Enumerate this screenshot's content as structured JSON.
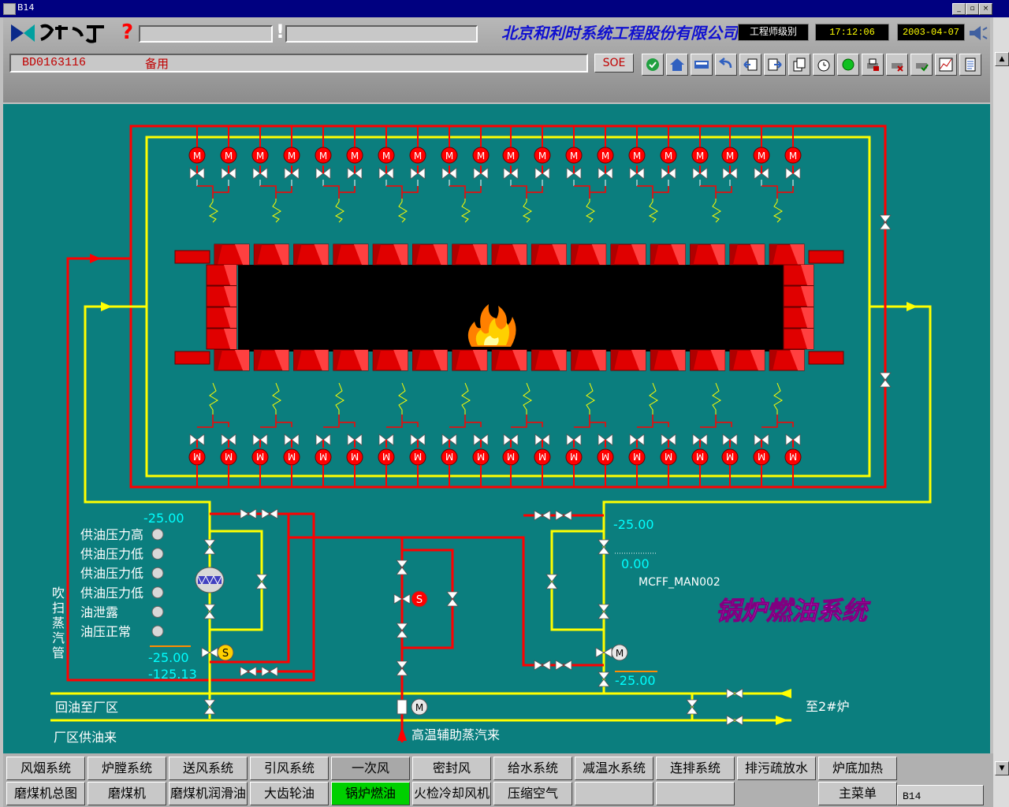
{
  "window": {
    "title": "B14",
    "min": "_",
    "max": "▫",
    "close": "×"
  },
  "header": {
    "help_symbol": "?",
    "alarm_symbol": "!",
    "company": "北京和利时系统工程股份有限公司",
    "user_level": "工程师级别",
    "time": "17:12:06",
    "date": "2003-04-07",
    "point_id": "BD0163116",
    "point_desc": "备用",
    "soe_label": "SOE",
    "toolbar_icons": [
      "globe-check-icon",
      "house-icon",
      "bus-icon",
      "back-arrow-icon",
      "page-left-icon",
      "page-right-icon",
      "copy-pages-icon",
      "clock-icon",
      "green-ball-icon",
      "printer-icon",
      "alarm-cancel-icon",
      "confirm-icon",
      "trend-chart-icon",
      "report-icon"
    ]
  },
  "diagram": {
    "title": "锅炉燃油系统",
    "interlocks": [
      "供油压力高",
      "供油压力低",
      "供油压力低",
      "供油压力低",
      "油泄露",
      "油压正常"
    ],
    "values": {
      "left_top": "-25.00",
      "left_mid": "-25.00",
      "left_bottom": "-125.13",
      "right_top": "-25.00",
      "right_mid": "0.00",
      "right_bottom": "-25.00"
    },
    "tag_name": "MCFF_MAN002",
    "steam_pipe_label": "吹扫蒸汽管",
    "return_oil_label": "回油至厂区",
    "supply_oil_label": "厂区供油来",
    "to_boiler2_label": "至2#炉",
    "aux_steam_label": "高温辅助蒸汽来",
    "motor_label": "M",
    "solenoid_label": "S",
    "colors": {
      "background": "#0b7e7e",
      "oil_supply": "#ffff00",
      "steam": "#ff0000",
      "values": "#00ffff",
      "title": "#ff30ff"
    }
  },
  "nav": {
    "row1": [
      "风烟系统",
      "炉膛系统",
      "送风系统",
      "引风系统",
      "一次风",
      "密封风",
      "给水系统",
      "减温水系统",
      "连排系统",
      "排污疏放水",
      "炉底加热"
    ],
    "row2": [
      "磨煤机总图",
      "磨煤机",
      "磨煤机润滑油",
      "大齿轮油",
      "锅炉燃油",
      "火检冷却风机",
      "压缩空气",
      "",
      "",
      "主菜单"
    ],
    "active": "锅炉燃油",
    "status": "B14"
  }
}
